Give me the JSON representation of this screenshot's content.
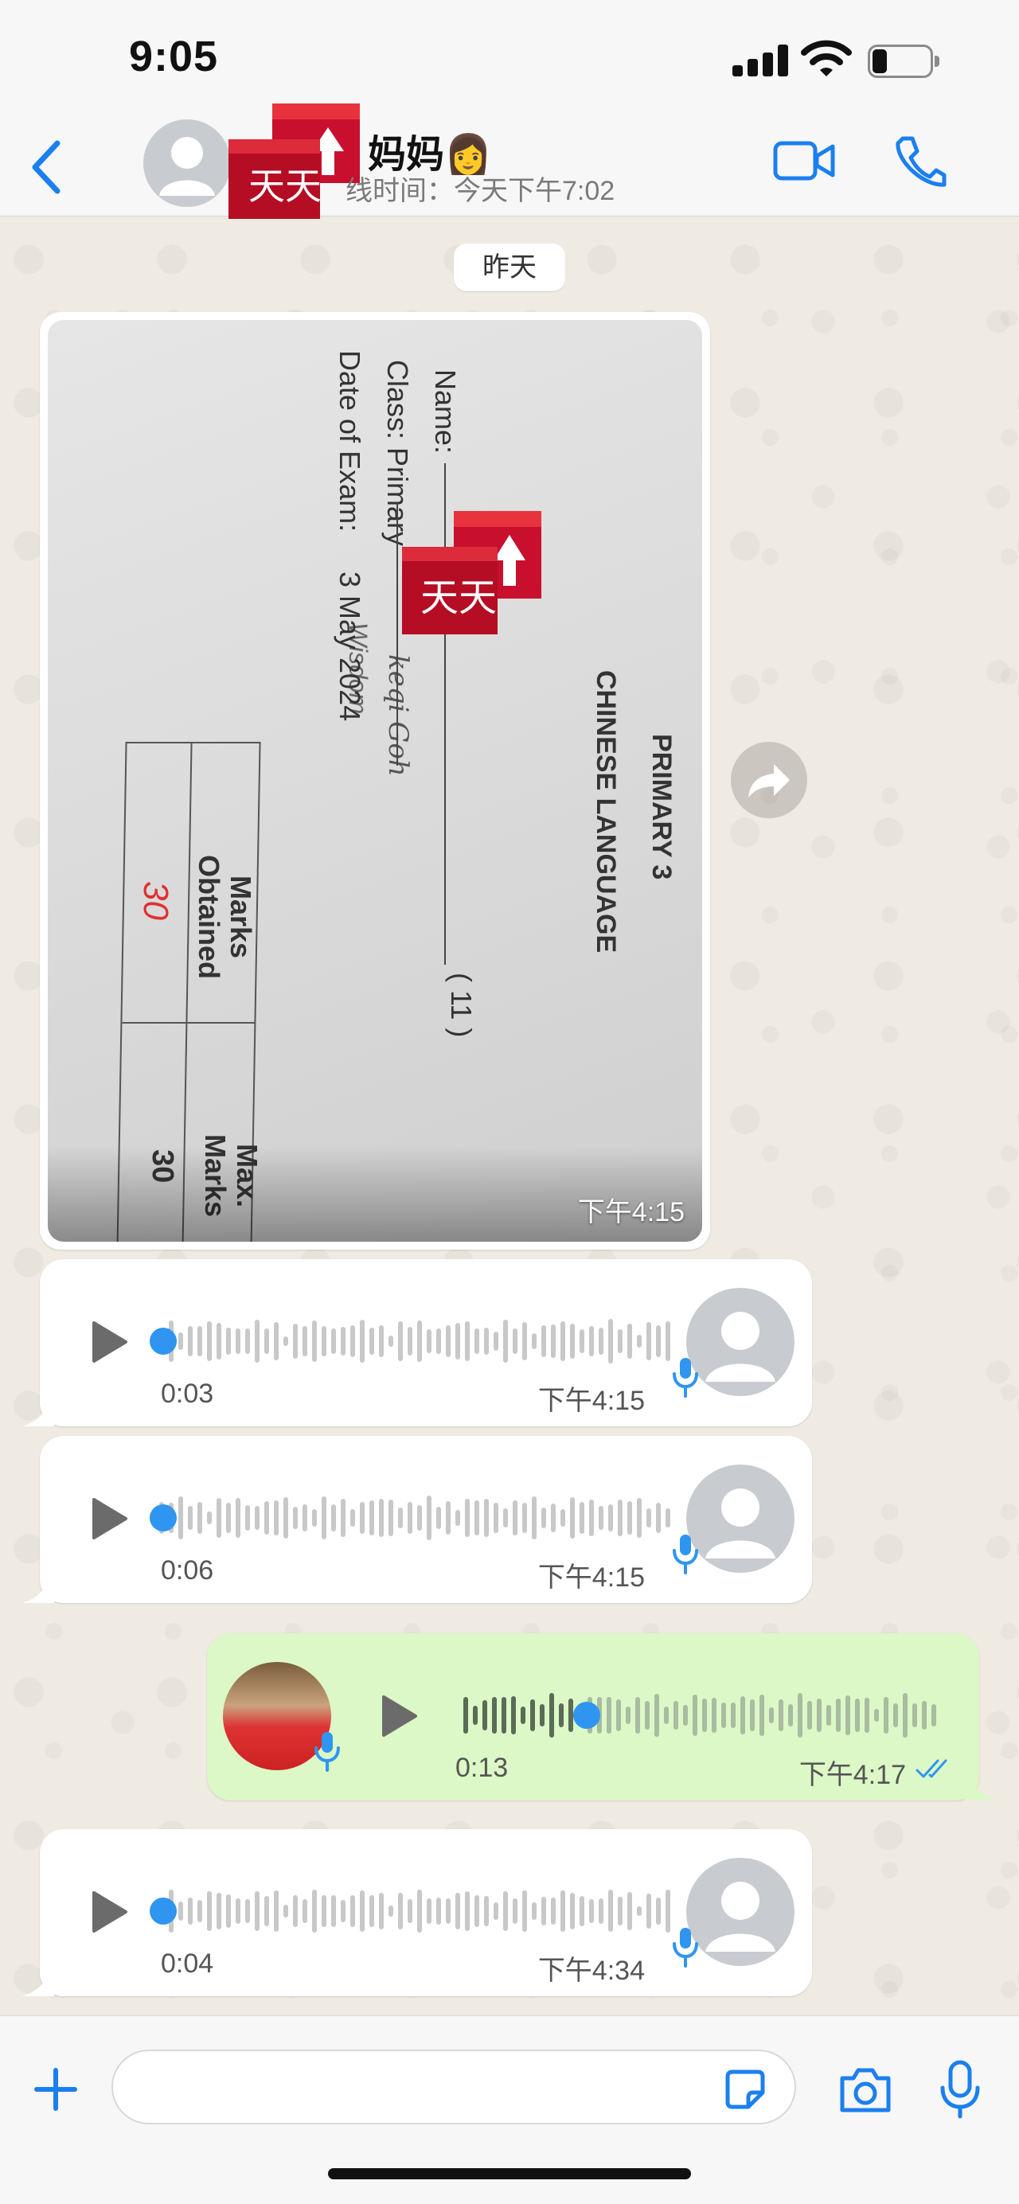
{
  "status_bar": {
    "time": "9:05",
    "battery_level": 0.2
  },
  "header": {
    "contact_name": "妈妈👩",
    "last_seen": "线时间：今天下午7:02",
    "sticker_text": "天天"
  },
  "date_separator": "昨天",
  "image_message": {
    "time": "下午4:15",
    "photo_text": {
      "level": "PRIMARY 3",
      "subject": "CHINESE LANGUAGE",
      "name_label": "Name:",
      "name_value": "keqi Goh",
      "number": "( 11 )",
      "class_label": "Class: Primary",
      "class_value": "Wisdom",
      "date_label": "Date of Exam:",
      "date_value": "3 May 2024",
      "marks_obtained_label": "Marks Obtained",
      "marks_obtained_value": "30",
      "max_marks_label": "Max. Marks",
      "max_marks_value": "30"
    }
  },
  "voice_messages": [
    {
      "direction": "incoming",
      "duration": "0:03",
      "time": "下午4:15",
      "progress": 0
    },
    {
      "direction": "incoming",
      "duration": "0:06",
      "time": "下午4:15",
      "progress": 0
    },
    {
      "direction": "outgoing",
      "duration": "0:13",
      "time": "下午4:17",
      "progress": 0.25,
      "status": "read"
    },
    {
      "direction": "incoming",
      "duration": "0:04",
      "time": "下午4:34",
      "progress": 0
    }
  ],
  "composer": {
    "placeholder": ""
  },
  "colors": {
    "accent": "#2f95f0",
    "outgoing_bubble": "#dcf8c6",
    "incoming_bubble": "#ffffff",
    "chat_background": "#efeae2"
  }
}
